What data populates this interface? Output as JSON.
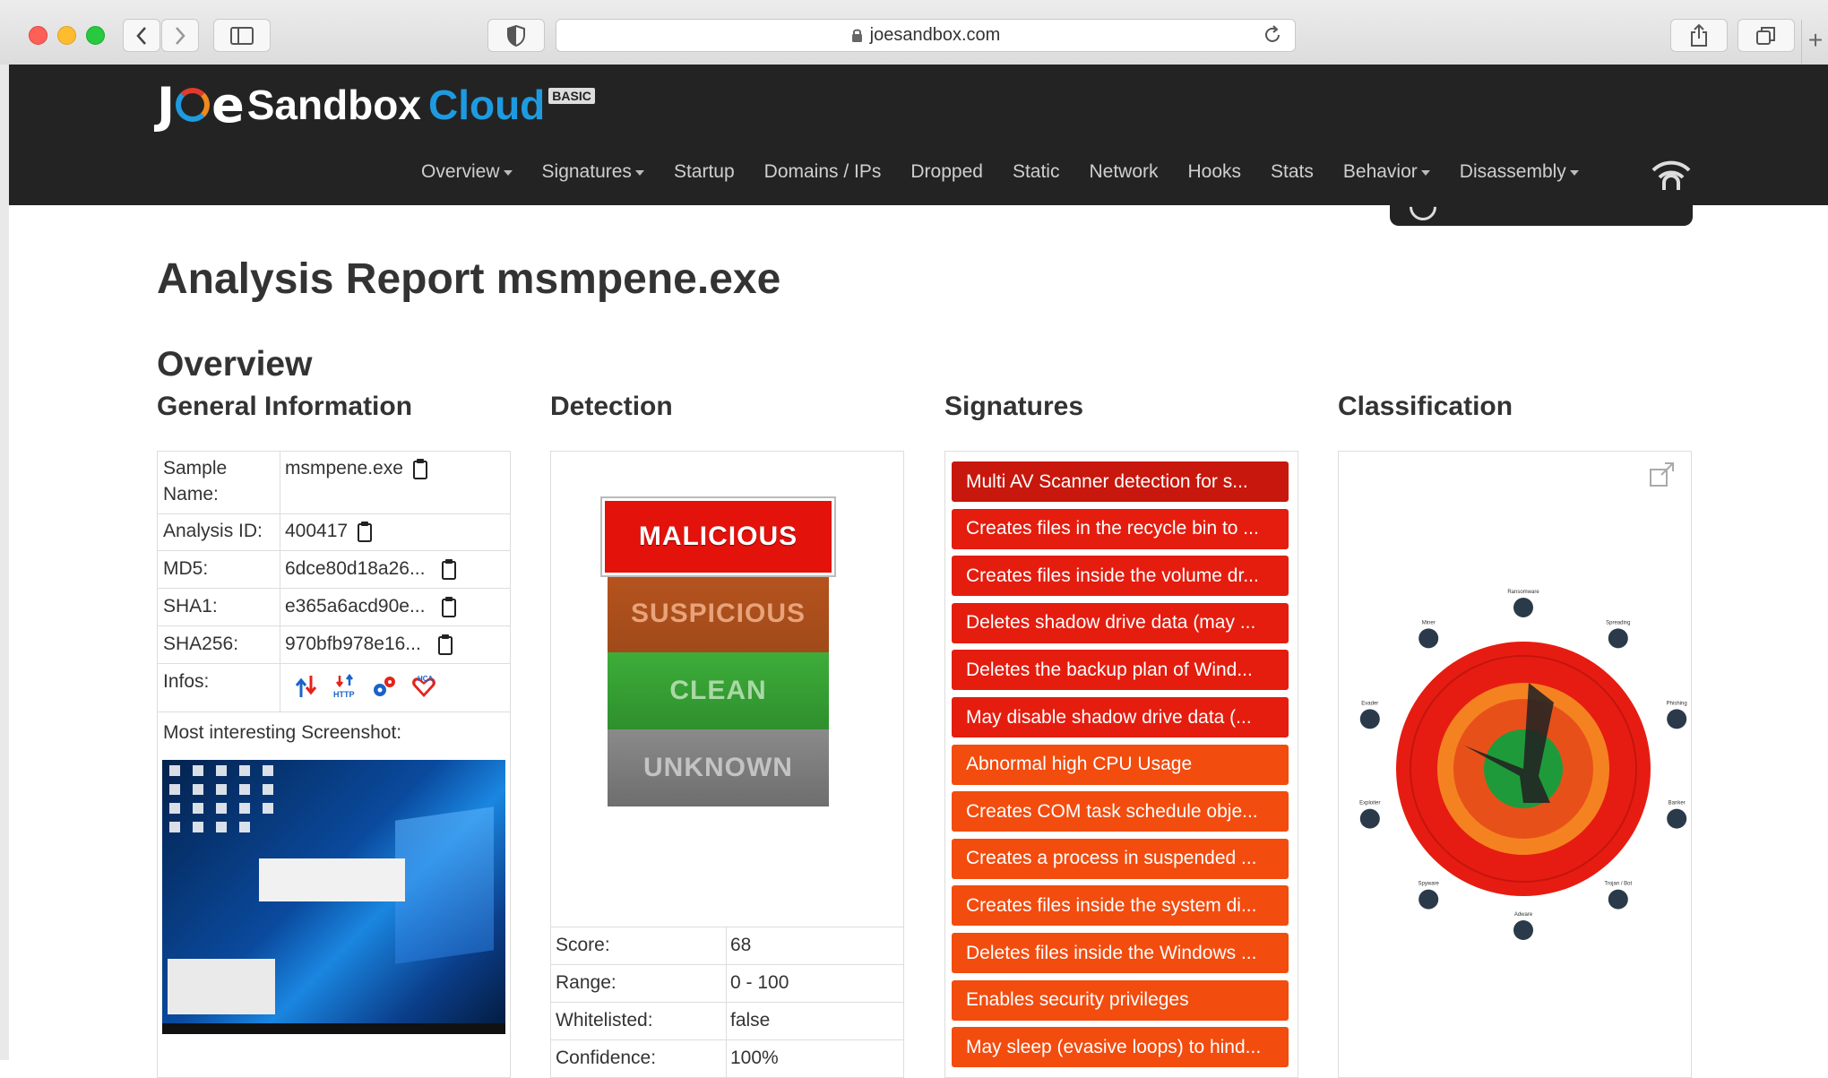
{
  "browser": {
    "url": "joesandbox.com"
  },
  "site": {
    "logo_joe": "J",
    "logo_e": "e",
    "logo_sandbox": "Sandbox",
    "logo_cloud": "Cloud",
    "logo_badge": "BASIC",
    "nav": [
      {
        "label": "Overview",
        "dropdown": true
      },
      {
        "label": "Signatures",
        "dropdown": true
      },
      {
        "label": "Startup",
        "dropdown": false
      },
      {
        "label": "Domains / IPs",
        "dropdown": false
      },
      {
        "label": "Dropped",
        "dropdown": false
      },
      {
        "label": "Static",
        "dropdown": false
      },
      {
        "label": "Network",
        "dropdown": false
      },
      {
        "label": "Hooks",
        "dropdown": false
      },
      {
        "label": "Stats",
        "dropdown": false
      },
      {
        "label": "Behavior",
        "dropdown": true
      },
      {
        "label": "Disassembly",
        "dropdown": true
      }
    ]
  },
  "page": {
    "title": "Analysis Report msmpene.exe",
    "overview_heading": "Overview",
    "columns": {
      "general": "General Information",
      "detection": "Detection",
      "signatures": "Signatures",
      "classification": "Classification"
    }
  },
  "general_info": {
    "sample_name_key": "Sample Name:",
    "sample_name": "msmpene.exe",
    "analysis_id_key": "Analysis ID:",
    "analysis_id": "400417",
    "md5_key": "MD5:",
    "md5": "6dce80d18a26...",
    "sha1_key": "SHA1:",
    "sha1": "e365a6acd90e...",
    "sha256_key": "SHA256:",
    "sha256": "970bfb978e16...",
    "infos_key": "Infos:",
    "infos_icons": [
      "network-arrows-icon",
      "http-icon",
      "gears-icon",
      "hca-icon"
    ],
    "infos_http_label": "HTTP",
    "infos_hca_label": "HCA",
    "screenshot_label": "Most interesting Screenshot:"
  },
  "detection": {
    "levels": [
      "MALICIOUS",
      "SUSPICIOUS",
      "CLEAN",
      "UNKNOWN"
    ],
    "active": "MALICIOUS",
    "score_key": "Score:",
    "score": "68",
    "range_key": "Range:",
    "range": "0 - 100",
    "whitelisted_key": "Whitelisted:",
    "whitelisted": "false",
    "confidence_key": "Confidence:",
    "confidence": "100%"
  },
  "signatures": [
    {
      "label": "Multi AV Scanner detection for s...",
      "color": "#c8170c"
    },
    {
      "label": "Creates files in the recycle bin to ...",
      "color": "#e41d0f"
    },
    {
      "label": "Creates files inside the volume dr...",
      "color": "#e41d0f"
    },
    {
      "label": "Deletes shadow drive data (may ...",
      "color": "#e41d0f"
    },
    {
      "label": "Deletes the backup plan of Wind...",
      "color": "#e41d0f"
    },
    {
      "label": "May disable shadow drive data (...",
      "color": "#e41d0f"
    },
    {
      "label": "Abnormal high CPU Usage",
      "color": "#f24c0f"
    },
    {
      "label": "Creates COM task schedule obje...",
      "color": "#f24c0f"
    },
    {
      "label": "Creates a process in suspended ...",
      "color": "#f24c0f"
    },
    {
      "label": "Creates files inside the system di...",
      "color": "#f24c0f"
    },
    {
      "label": "Deletes files inside the Windows ...",
      "color": "#f24c0f"
    },
    {
      "label": "Enables security privileges",
      "color": "#f24c0f"
    },
    {
      "label": "May sleep (evasive loops) to hind...",
      "color": "#f24c0f"
    }
  ],
  "classification": {
    "categories": [
      "Ransomware",
      "Spreading",
      "Phishing",
      "Banker",
      "Trojan / Bot",
      "Adware",
      "Spyware",
      "Exploiter",
      "Evader",
      "Miner"
    ],
    "ring_colors": {
      "outer": "#e61c12",
      "mid": "#f58220",
      "inner": "#e8501a",
      "core": "#1f9a3a"
    }
  }
}
